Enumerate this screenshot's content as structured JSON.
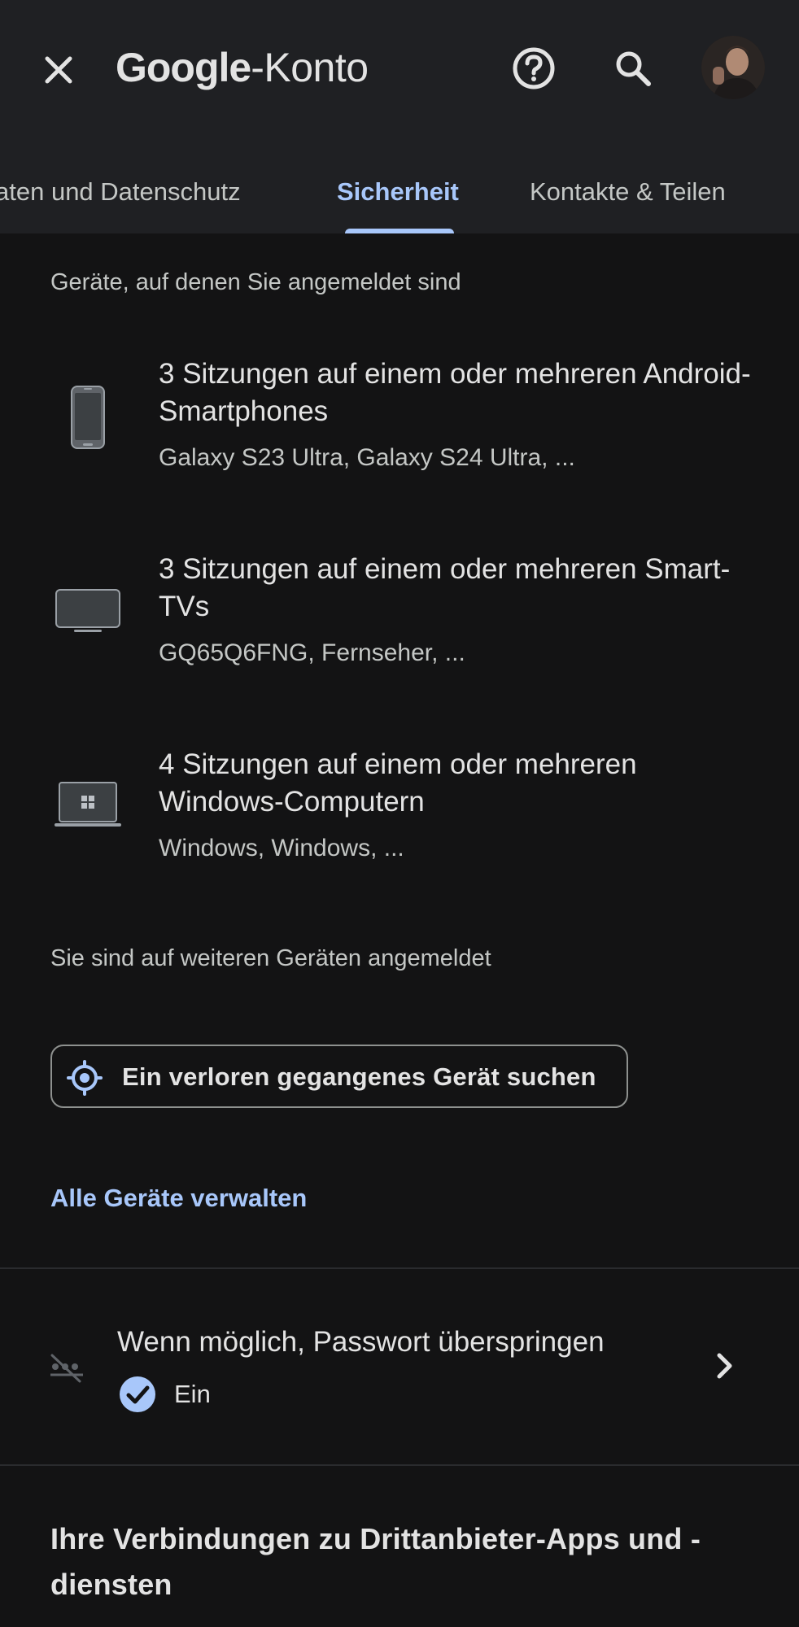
{
  "header": {
    "brand": "Google",
    "title_suffix": "-Konto",
    "close_icon": "close-icon",
    "help_icon": "help-circle-icon",
    "search_icon": "search-icon",
    "avatar_icon": "user-avatar"
  },
  "tabs": [
    {
      "label": "aten und Datenschutz",
      "active": false
    },
    {
      "label": "Sicherheit",
      "active": true
    },
    {
      "label": "Kontakte & Teilen",
      "active": false
    }
  ],
  "devices_section": {
    "label": "Geräte, auf denen Sie angemeldet sind",
    "devices": [
      {
        "title": "3 Sitzungen auf einem oder mehreren Android-Smartphones",
        "subtitle": "Galaxy S23 Ultra, Galaxy S24 Ultra, ...",
        "icon": "smartphone-icon"
      },
      {
        "title": "3 Sitzungen auf einem oder mehreren Smart-TVs",
        "subtitle": "GQ65Q6FNG, Fernseher, ...",
        "icon": "tv-icon"
      },
      {
        "title": "4 Sitzungen auf einem oder mehreren Windows-Computern",
        "subtitle": "Windows, Windows, ...",
        "icon": "windows-laptop-icon"
      }
    ],
    "more_label": "Sie sind auf weiteren Geräten angemeldet",
    "find_button": "Ein verloren gegangenes Gerät suchen",
    "manage_link": "Alle Geräte verwalten"
  },
  "passkey": {
    "title": "Wenn möglich, Passwort überspringen",
    "status": "Ein",
    "icon": "password-off-icon",
    "status_icon": "check-circle-icon"
  },
  "connections": {
    "title": "Ihre Verbindungen zu Drittanbieter-Apps und -diensten"
  },
  "colors": {
    "background": "#131314",
    "header_background": "#1f2023",
    "accent": "#a8c7fa",
    "check_fill": "#a8c7fa"
  }
}
